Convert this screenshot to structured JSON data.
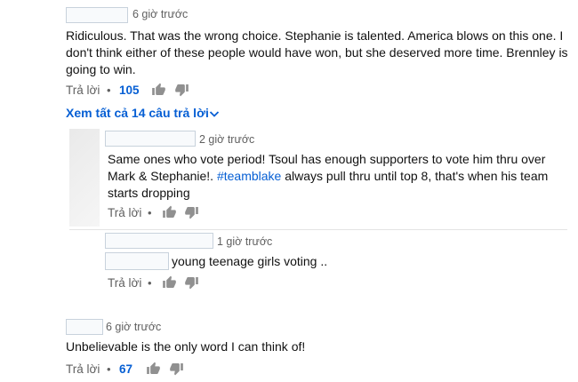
{
  "comments": [
    {
      "time": "6 giờ trước",
      "text": "Ridiculous. That was the wrong choice. Stephanie is talented. America blows on this one. I don't think either of these people would have won, but she deserved more time. Brennley is going to win.",
      "reply_label": "Trả lời",
      "likes": "105",
      "view_replies": "Xem tất cả 14 câu trả lời"
    },
    {
      "time": "6 giờ trước",
      "text": "Unbelievable is the only word I can think of!",
      "reply_label": "Trả lời",
      "likes": "67"
    }
  ],
  "replies": [
    {
      "time": "2 giờ trước",
      "text_before": "Same ones who vote period! Tsoul has enough supporters to vote him thru over Mark & Stephanie!. ",
      "hashtag": "#teamblake",
      "text_after": " always pull thru until top 8, that's when his team starts dropping",
      "reply_label": "Trả lời"
    },
    {
      "time": "1 giờ trước",
      "text": "young teenage girls voting ..",
      "reply_label": "Trả lời"
    }
  ],
  "dot": "•",
  "colors": {
    "link": "#065fd4",
    "meta": "#606060",
    "text": "#111111"
  },
  "icons": [
    "like-icon",
    "dislike-icon",
    "chevron-down-icon"
  ]
}
